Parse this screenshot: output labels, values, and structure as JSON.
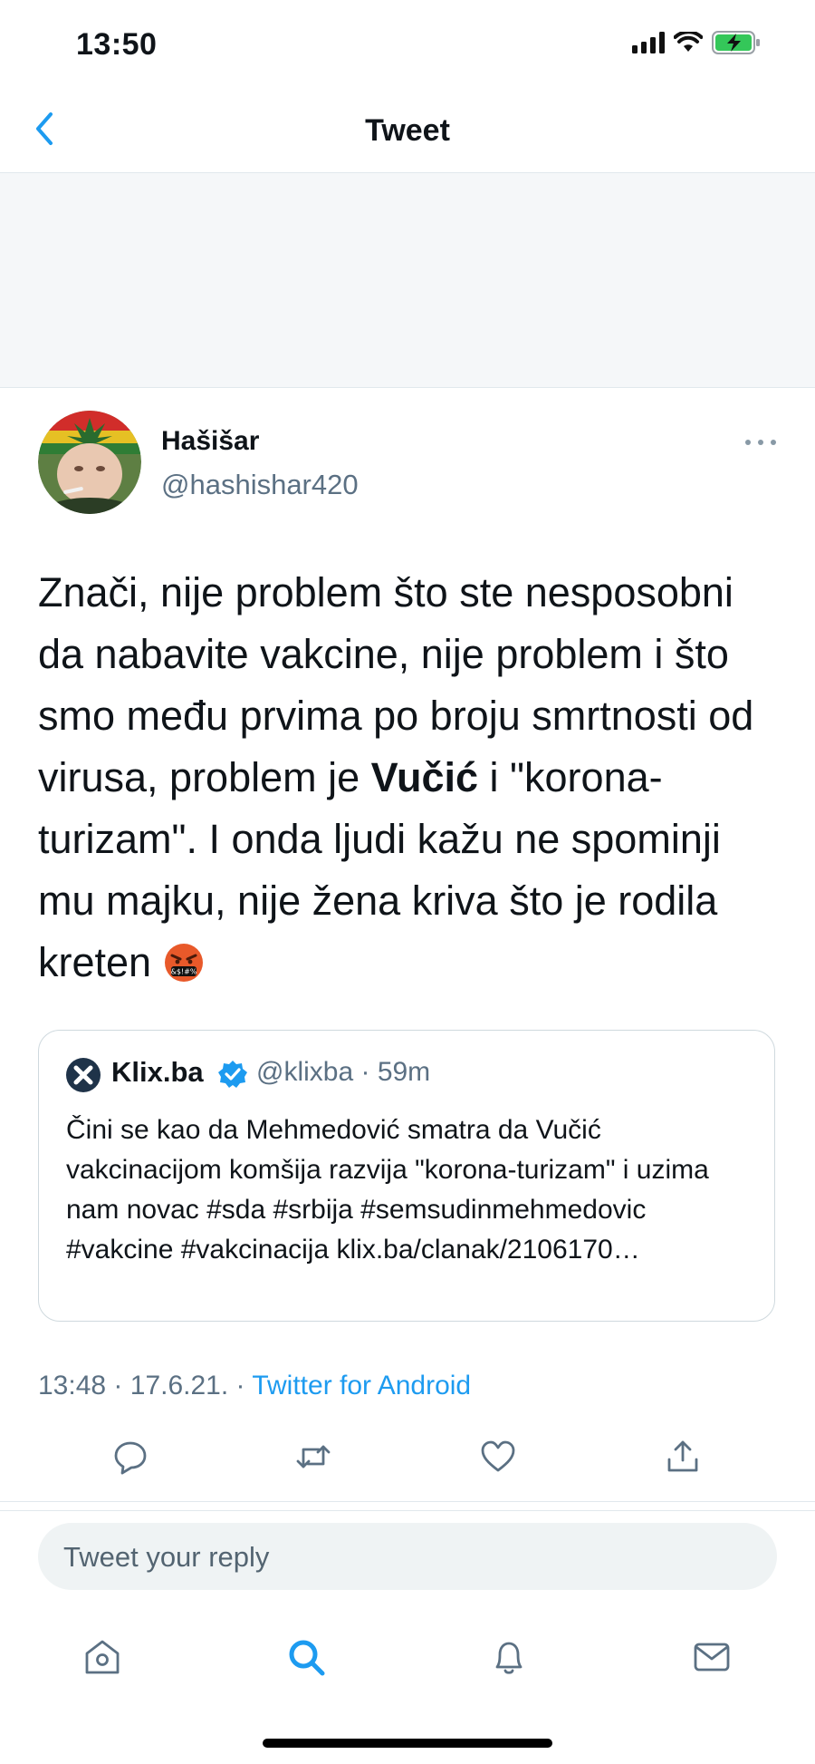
{
  "status_bar": {
    "time": "13:50"
  },
  "nav": {
    "title": "Tweet"
  },
  "tweet": {
    "author_name": "Hašišar",
    "author_handle": "@hashishar420",
    "body_before": "Znači, nije problem što ste nesposobni da nabavite vakcine, nije problem i što smo među prvima po broju smrtnosti od virusa, problem je ",
    "body_bold": "Vučić",
    "body_after": " i \"korona-turizam\". I onda ljudi kažu ne spominji mu majku, nije žena kriva što je rodila kreten",
    "time": "13:48",
    "date": "17.6.21.",
    "source": "Twitter for Android",
    "separator": "·"
  },
  "quoted_tweet": {
    "name": "Klix.ba",
    "meta": "@klixba · 59m",
    "text": "Čini se kao da Mehmedović smatra da Vučić vakcinacijom komšija razvija \"korona-turizam\" i uzima nam novac #sda #srbija #semsudinmehmedovic #vakcine #vakcinacija klix.ba/clanak/2106170…"
  },
  "reply": {
    "placeholder": "Tweet your reply"
  },
  "colors": {
    "accent": "#1d9bf0",
    "muted": "#5b7083",
    "text": "#0f1419"
  },
  "icons": {
    "actions": [
      "reply-icon",
      "retweet-icon",
      "like-icon",
      "share-icon"
    ],
    "tabs": [
      "home-icon",
      "search-icon",
      "notifications-icon",
      "messages-icon"
    ]
  }
}
